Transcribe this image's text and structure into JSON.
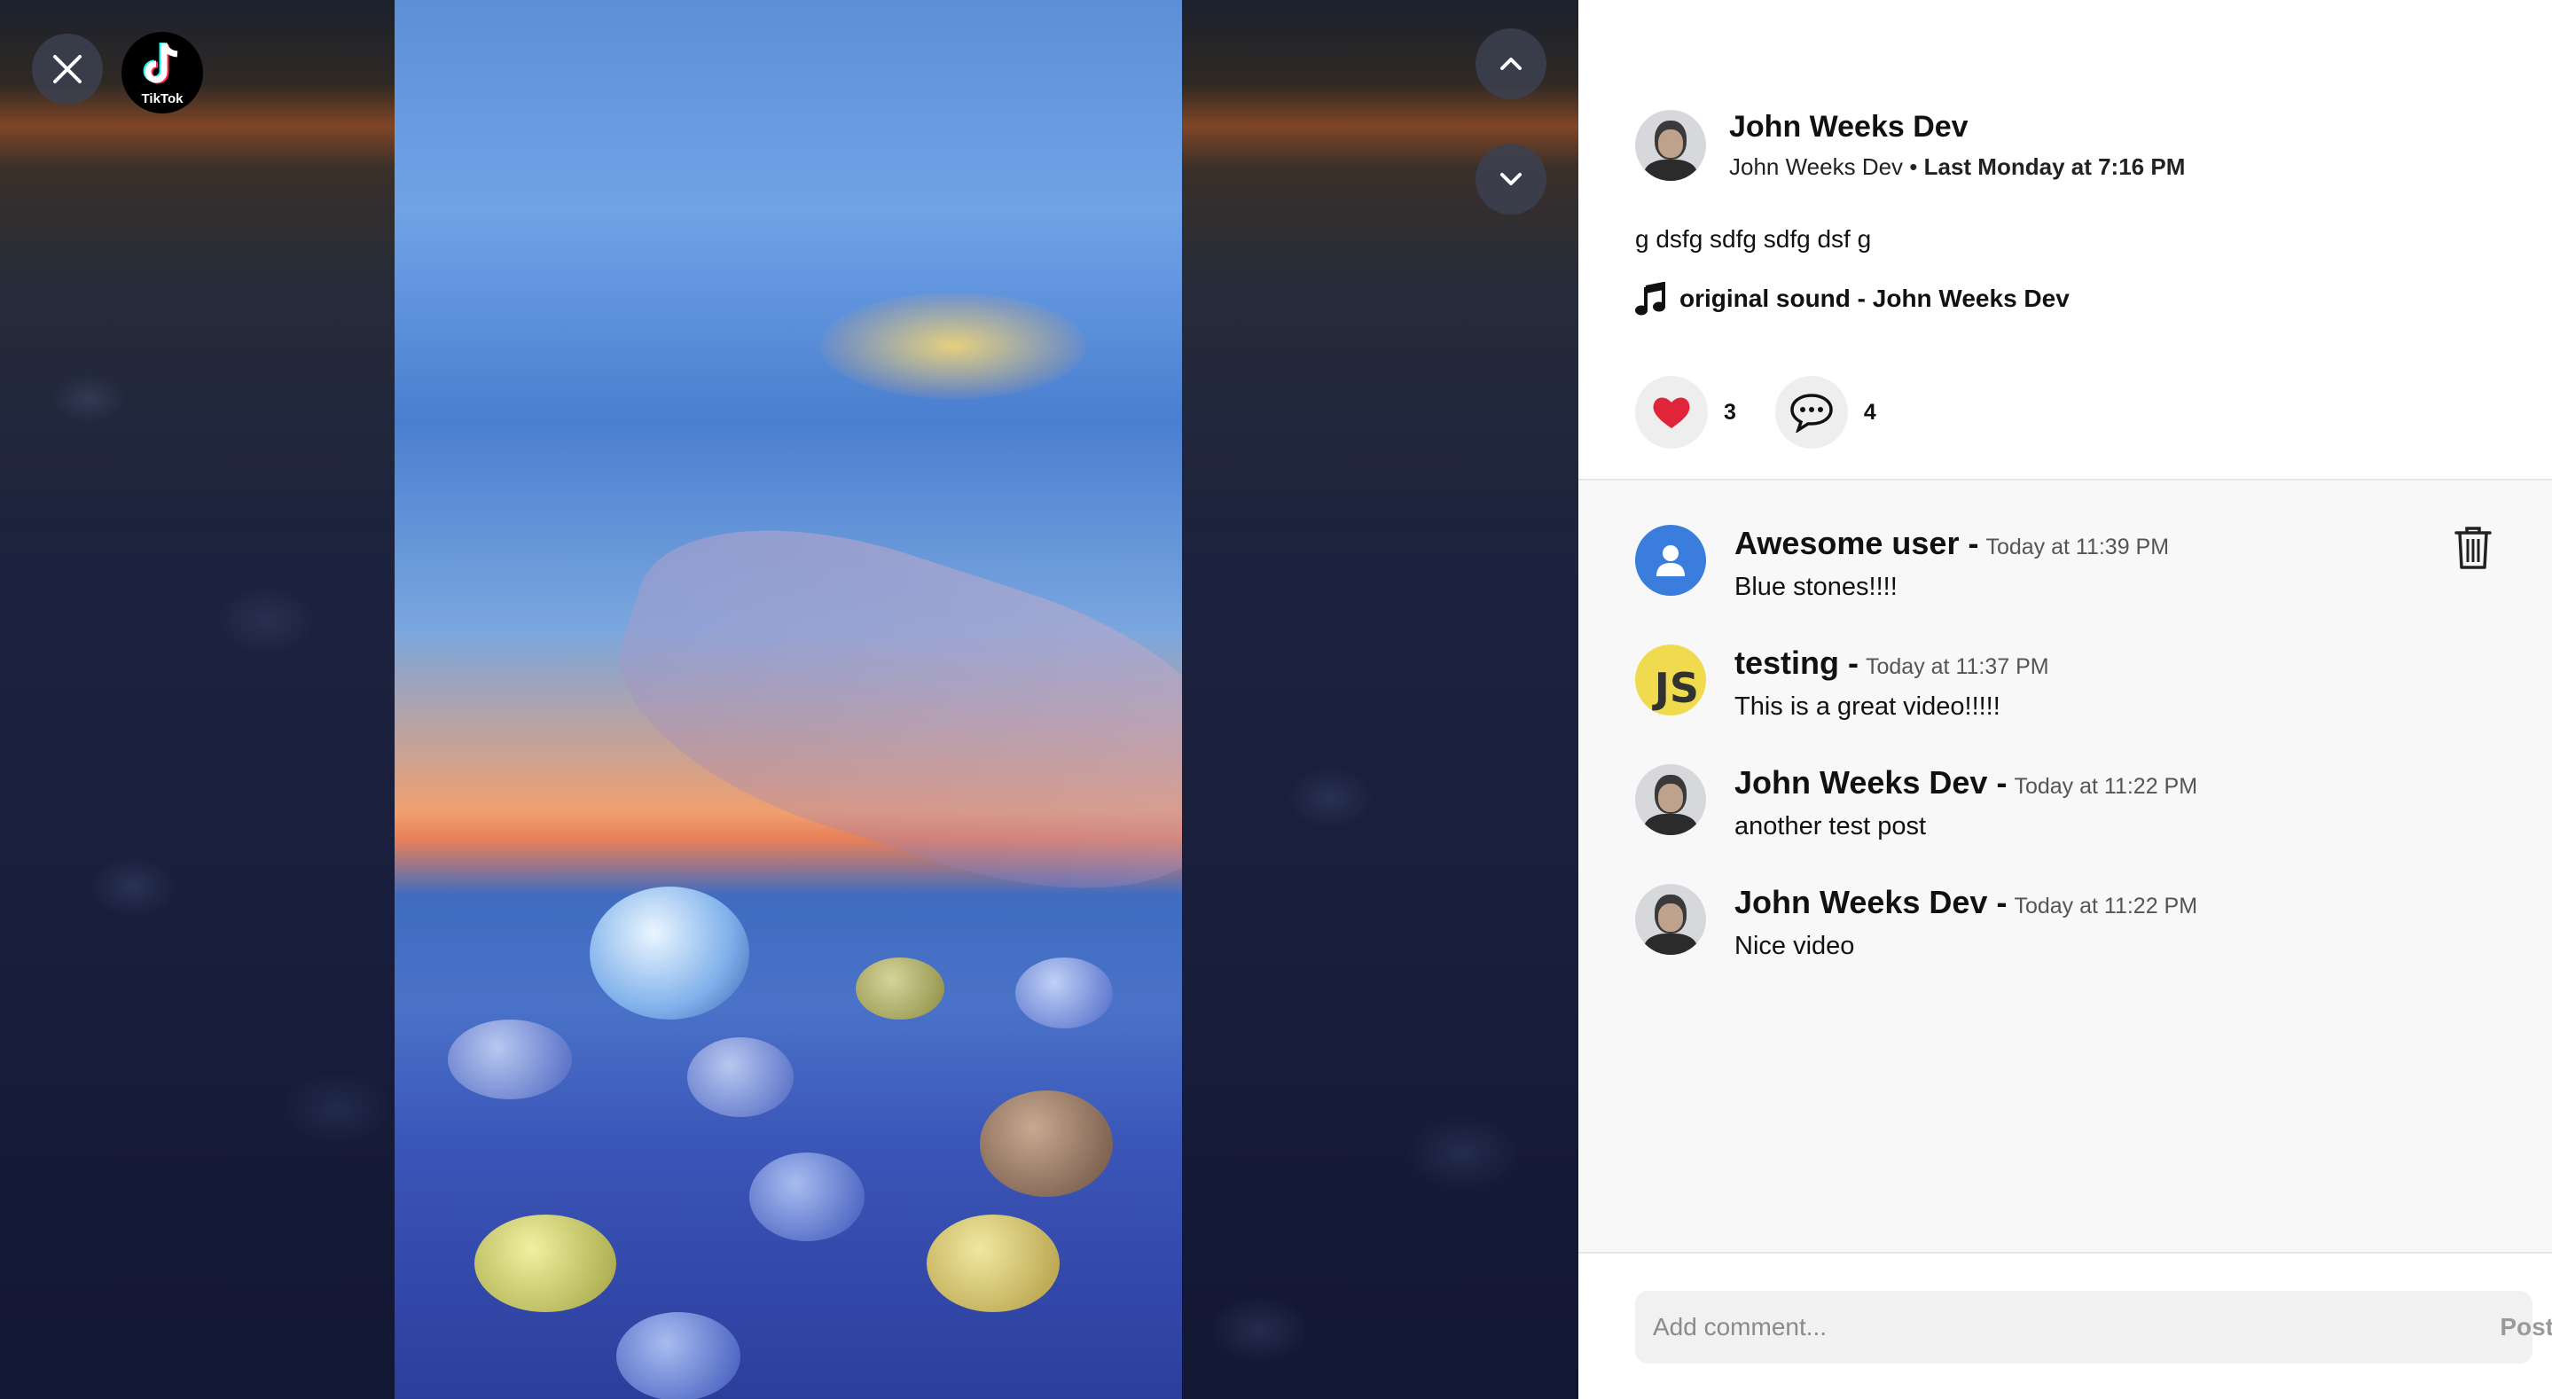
{
  "viewer": {
    "logo_text": "TikTok"
  },
  "post": {
    "author_name": "John Weeks Dev",
    "author_sub": "John Weeks Dev",
    "date": "Last Monday at 7:16 PM",
    "caption": "g dsfg sdfg sdfg dsf g",
    "sound": "original sound - John Weeks Dev",
    "likes": "3",
    "comments_count": "4"
  },
  "comments": [
    {
      "name": "Awesome user -",
      "time": "Today at 11:39 PM",
      "text": "Blue stones!!!!",
      "avatar": "default-user-icon"
    },
    {
      "name": "testing -",
      "time": "Today at 11:37 PM",
      "text": "This is a great video!!!!!",
      "avatar": "js-logo"
    },
    {
      "name": "John Weeks Dev -",
      "time": "Today at 11:22 PM",
      "text": "another test post",
      "avatar": "photo"
    },
    {
      "name": "John Weeks Dev -",
      "time": "Today at 11:22 PM",
      "text": "Nice video",
      "avatar": "photo"
    }
  ],
  "comment_box": {
    "placeholder": "Add comment...",
    "post_label": "Post"
  },
  "colors": {
    "like": "#e0243a",
    "avatar_blue": "#3b7ddd",
    "js_yellow": "#f0db4f"
  }
}
